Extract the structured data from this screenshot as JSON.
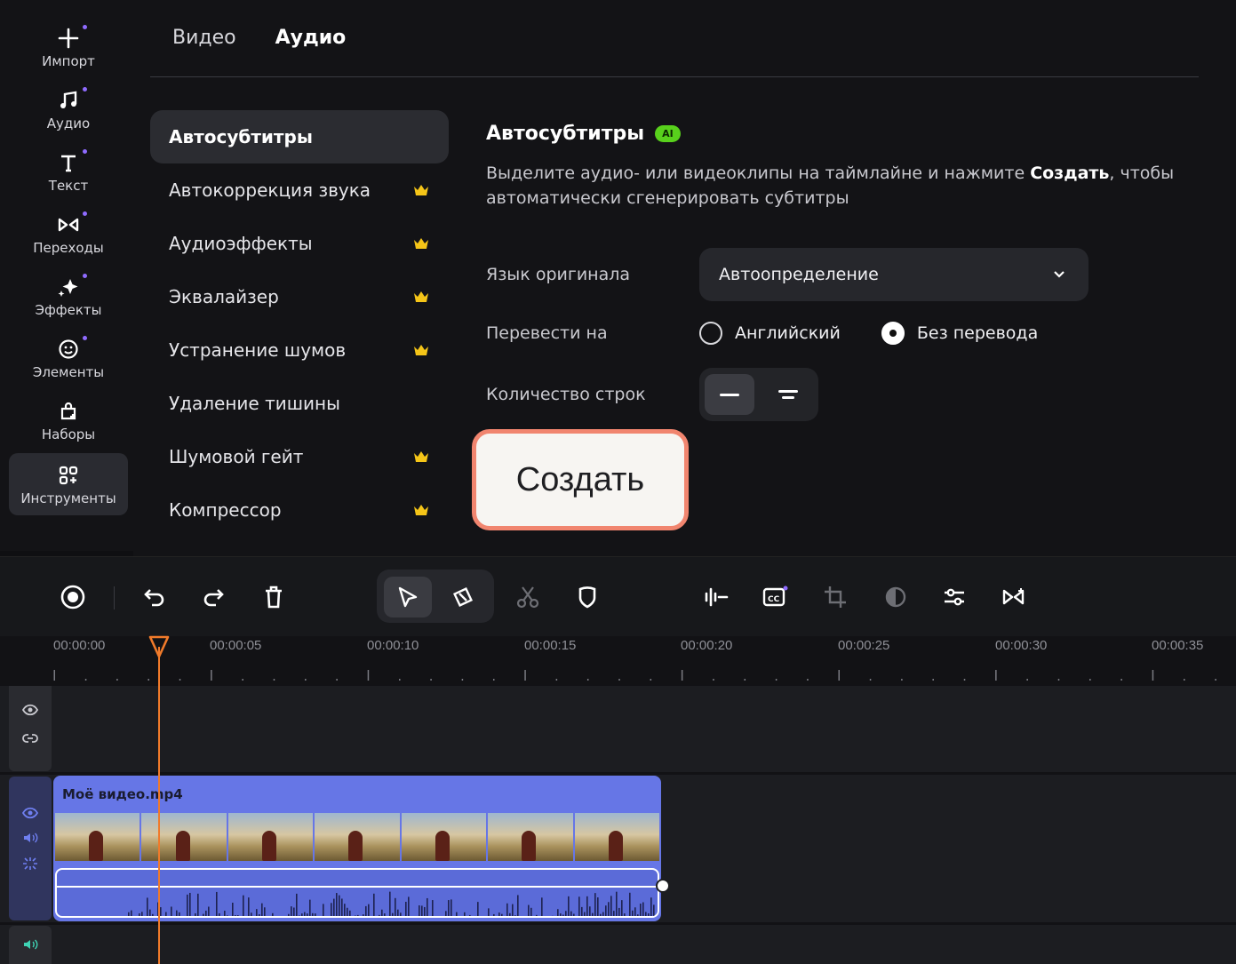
{
  "sidebar": {
    "items": [
      {
        "label": "Импорт",
        "icon": "plus-icon"
      },
      {
        "label": "Аудио",
        "icon": "music-note-icon"
      },
      {
        "label": "Текст",
        "icon": "text-icon"
      },
      {
        "label": "Переходы",
        "icon": "transitions-icon"
      },
      {
        "label": "Эффекты",
        "icon": "sparkle-icon"
      },
      {
        "label": "Элементы",
        "icon": "smiley-icon"
      },
      {
        "label": "Наборы",
        "icon": "bag-icon"
      },
      {
        "label": "Инструменты",
        "icon": "tools-grid-icon",
        "active": true
      }
    ]
  },
  "tabs": {
    "video": "Видео",
    "audio": "Аудио",
    "active": "audio"
  },
  "menu": {
    "items": [
      {
        "label": "Автосубтитры",
        "premium": false,
        "active": true
      },
      {
        "label": "Автокоррекция звука",
        "premium": true
      },
      {
        "label": "Аудиоэффекты",
        "premium": true
      },
      {
        "label": "Эквалайзер",
        "premium": true
      },
      {
        "label": "Устранение шумов",
        "premium": true
      },
      {
        "label": "Удаление тишины",
        "premium": false
      },
      {
        "label": "Шумовой гейт",
        "premium": true
      },
      {
        "label": "Компрессор",
        "premium": true
      }
    ]
  },
  "content": {
    "title": "Автосубтитры",
    "ai_badge": "AI",
    "desc_before": "Выделите аудио- или видеоклипы на таймлайне и нажмите ",
    "desc_bold": "Создать",
    "desc_after": ", чтобы автоматически сгенерировать субтитры",
    "lang_label": "Язык оригинала",
    "lang_value": "Автоопределение",
    "translate_label": "Перевести на",
    "translate_options": [
      {
        "label": "Английский",
        "selected": false
      },
      {
        "label": "Без перевода",
        "selected": true
      }
    ],
    "lines_label": "Количество строк",
    "create_label": "Создать"
  },
  "ruler": {
    "labels": [
      "00:00:00",
      "00:00:05",
      "00:00:10",
      "00:00:15",
      "00:00:20",
      "00:00:25",
      "00:00:30",
      "00:00:35"
    ]
  },
  "timeline": {
    "clip_name": "Моё видео.mp4",
    "playhead_time": "00:00:00.7"
  },
  "colors": {
    "accent": "#f07a2a",
    "clip": "#6676e6",
    "ai_badge": "#58d11c",
    "create_border": "#f1856f",
    "premium_crown": "#f5c518"
  }
}
